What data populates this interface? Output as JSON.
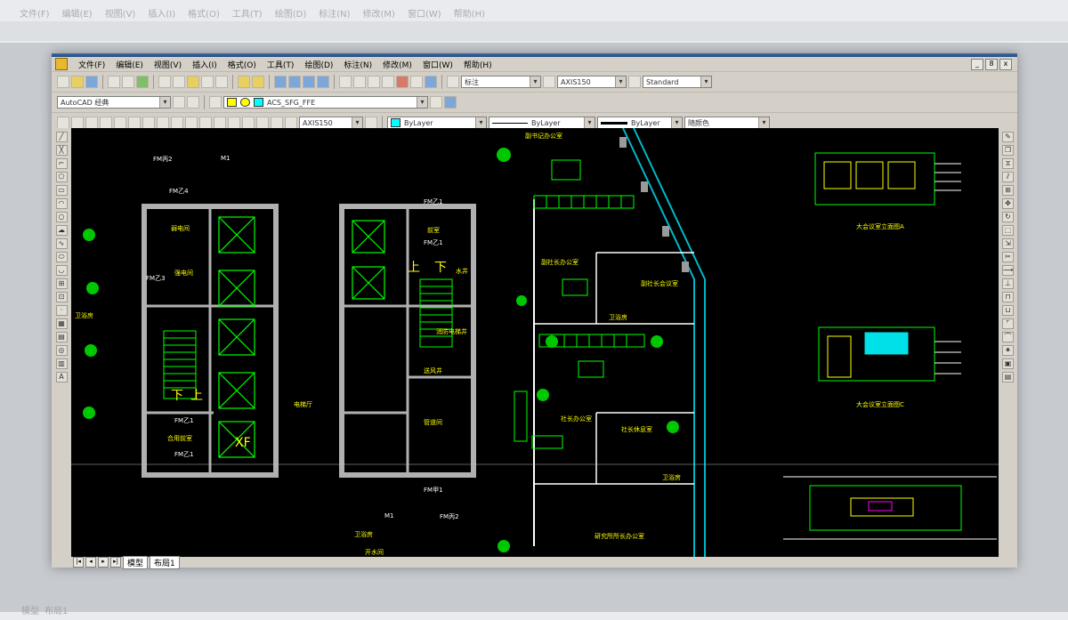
{
  "background_app": {
    "menus": [
      "文件(F)",
      "编辑(E)",
      "视图(V)",
      "插入(I)",
      "格式(O)",
      "工具(T)",
      "绘图(D)",
      "标注(N)",
      "修改(M)",
      "窗口(W)",
      "帮助(H)"
    ],
    "tabs": [
      "模型",
      "布局1"
    ]
  },
  "window": {
    "menus": [
      "文件(F)",
      "编辑(E)",
      "视图(V)",
      "插入(I)",
      "格式(O)",
      "工具(T)",
      "绘图(D)",
      "标注(N)",
      "修改(M)",
      "窗口(W)",
      "帮助(H)"
    ],
    "window_controls": [
      "_",
      "8",
      "x"
    ],
    "toolbar1": {
      "text_style": "标注",
      "dim_style": "AXIS150",
      "table_style": "Standard"
    },
    "toolbar2": {
      "workspace": "AutoCAD 经典",
      "layer": "ACS_SFG_FFE"
    },
    "toolbar3": {
      "dim_style": "AXIS150",
      "color": "ByLayer",
      "linetype": "ByLayer",
      "lineweight": "ByLayer",
      "plot_style": "随颜色"
    },
    "tabs": [
      "模型",
      "布局1"
    ]
  },
  "drawing_labels": {
    "fm2_top": "FM丙2",
    "m1_top": "M1",
    "fm4": "FM乙4",
    "fm1_a": "FM乙1",
    "fm1_b": "FM乙1",
    "fm3": "FM乙3",
    "fm1_c": "FM乙1",
    "fm1_d": "FM乙1",
    "fm1_e": "FM乙1",
    "fm1_bottom": "FM甲1",
    "fm2_bottom": "FM丙2",
    "m1_bottom": "M1",
    "elec_room": "弱电间",
    "strong_room": "强电间",
    "shared_hall": "合用前室",
    "front_room": "前室",
    "water_well": "水井",
    "fan_room": "送风井",
    "pipe_well": "管道间",
    "elevator_hall": "电梯厅",
    "up1": "上",
    "down1": "下",
    "up2": "上",
    "down2": "下",
    "xf": "XF",
    "office1": "副书记办公室",
    "office2": "副社长办公室",
    "office3": "副社长会议室",
    "office4": "社长办公室",
    "office5": "社长休息室",
    "toilet1": "卫浴房",
    "toilet2": "卫浴房",
    "toilet3": "卫浴房",
    "research": "研究所所长办公室",
    "boiler": "开水间",
    "fire_shaft": "消防电梯井",
    "elev_a": "大会议室立面图A",
    "elev_b": "大会议室立面图C",
    "toilet_left": "卫浴房"
  }
}
